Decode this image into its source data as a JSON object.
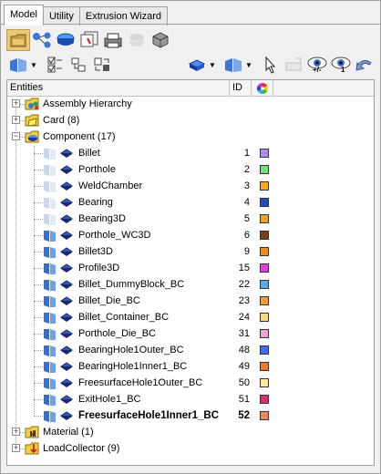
{
  "tabs": [
    "Model",
    "Utility",
    "Extrusion Wizard"
  ],
  "toolbar1": [
    "model-view-icon",
    "hierarchy-icon",
    "component-view-icon",
    "preview-icon",
    "print-icon",
    "layers-disabled-icon",
    "entity-state-icon"
  ],
  "toolbar2_left": [
    "display-mode-icon",
    "checklist-icon",
    "tree-expand-icon",
    "swap-icon"
  ],
  "toolbar2_right": [
    "shaded-solid-icon",
    "visualization-mode-icon",
    "select-arrow-icon",
    "clear-icon",
    "show-hide-eye-icon",
    "isolate-eye-icon",
    "undo-arrow-icon"
  ],
  "toolbar2_eye_labels": {
    "plusminus": "+/-",
    "one": "1"
  },
  "header": {
    "entities": "Entities",
    "id": "ID"
  },
  "tree": {
    "assembly": "Assembly Hierarchy",
    "card": "Card (8)",
    "component": "Component (17)",
    "material": "Material (1)",
    "loadcollector": "LoadCollector (9)"
  },
  "components": [
    {
      "name": "Billet",
      "id": "1",
      "color": "#b48cf0",
      "bold": false
    },
    {
      "name": "Porthole",
      "id": "2",
      "color": "#78e078",
      "bold": false
    },
    {
      "name": "WeldChamber",
      "id": "3",
      "color": "#f5a623",
      "bold": false
    },
    {
      "name": "Bearing",
      "id": "4",
      "color": "#1f4fb8",
      "bold": false
    },
    {
      "name": "Bearing3D",
      "id": "5",
      "color": "#f0a020",
      "bold": false
    },
    {
      "name": "Porthole_WC3D",
      "id": "6",
      "color": "#7a3c12",
      "bold": false
    },
    {
      "name": "Billet3D",
      "id": "9",
      "color": "#f08c1e",
      "bold": false
    },
    {
      "name": "Profile3D",
      "id": "15",
      "color": "#e040e0",
      "bold": false
    },
    {
      "name": "Billet_DummyBlock_BC",
      "id": "22",
      "color": "#5aaaf0",
      "bold": false
    },
    {
      "name": "Billet_Die_BC",
      "id": "23",
      "color": "#f0a030",
      "bold": false
    },
    {
      "name": "Billet_Container_BC",
      "id": "24",
      "color": "#f8d88a",
      "bold": false
    },
    {
      "name": "Porthole_Die_BC",
      "id": "31",
      "color": "#f0a0d8",
      "bold": false
    },
    {
      "name": "BearingHole1Outer_BC",
      "id": "48",
      "color": "#3c6ef0",
      "bold": false
    },
    {
      "name": "BearingHole1Inner1_BC",
      "id": "49",
      "color": "#f07830",
      "bold": false
    },
    {
      "name": "FreesurfaceHole1Outer_BC",
      "id": "50",
      "color": "#fce89a",
      "bold": false
    },
    {
      "name": "ExitHole1_BC",
      "id": "51",
      "color": "#d8306c",
      "bold": false
    },
    {
      "name": "FreesurfaceHole1Inner1_BC",
      "id": "52",
      "color": "#f08860",
      "bold": true
    }
  ]
}
